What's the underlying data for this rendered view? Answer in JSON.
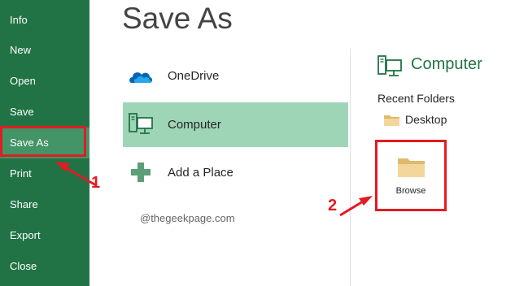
{
  "sidebar": {
    "items": [
      {
        "label": "Info"
      },
      {
        "label": "New"
      },
      {
        "label": "Open"
      },
      {
        "label": "Save"
      },
      {
        "label": "Save As",
        "active": true
      },
      {
        "label": "Print"
      },
      {
        "label": "Share"
      },
      {
        "label": "Export"
      },
      {
        "label": "Close"
      }
    ]
  },
  "page": {
    "title": "Save As",
    "watermark": "@thegeekpage.com"
  },
  "locations": [
    {
      "label": "OneDrive",
      "icon": "onedrive-cloud-icon"
    },
    {
      "label": "Computer",
      "icon": "computer-icon",
      "selected": true
    },
    {
      "label": "Add a Place",
      "icon": "plus-icon"
    }
  ],
  "right_panel": {
    "title": "Computer",
    "recent_folders_label": "Recent Folders",
    "folders": [
      {
        "label": "Desktop",
        "icon": "folder-icon"
      }
    ],
    "browse_label": "Browse"
  },
  "annotations": {
    "step1": "1",
    "step2": "2"
  },
  "colors": {
    "sidebar": "#217346",
    "sidebar_active": "#439467",
    "selected_location": "#9fd5b7",
    "highlight": "#e11c22",
    "accent_text": "#217346"
  }
}
